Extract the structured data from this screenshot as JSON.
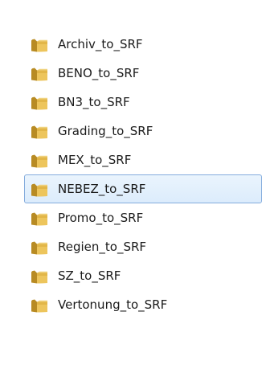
{
  "folders": [
    {
      "label": "Archiv_to_SRF",
      "icon": "folder-icon",
      "selected": false
    },
    {
      "label": "BENO_to_SRF",
      "icon": "folder-icon",
      "selected": false
    },
    {
      "label": "BN3_to_SRF",
      "icon": "folder-icon",
      "selected": false
    },
    {
      "label": "Grading_to_SRF",
      "icon": "folder-icon",
      "selected": false
    },
    {
      "label": "MEX_to_SRF",
      "icon": "folder-icon",
      "selected": false
    },
    {
      "label": "NEBEZ_to_SRF",
      "icon": "folder-icon",
      "selected": true
    },
    {
      "label": "Promo_to_SRF",
      "icon": "folder-icon",
      "selected": false
    },
    {
      "label": "Regien_to_SRF",
      "icon": "folder-icon",
      "selected": false
    },
    {
      "label": "SZ_to_SRF",
      "icon": "folder-icon",
      "selected": false
    },
    {
      "label": "Vertonung_to_SRF",
      "icon": "folder-icon",
      "selected": false
    }
  ],
  "colors": {
    "selection_fill": "#dcecfc",
    "selection_border": "#84acdd",
    "folder_body": "#e8c15a",
    "folder_back": "#c99a2e"
  }
}
